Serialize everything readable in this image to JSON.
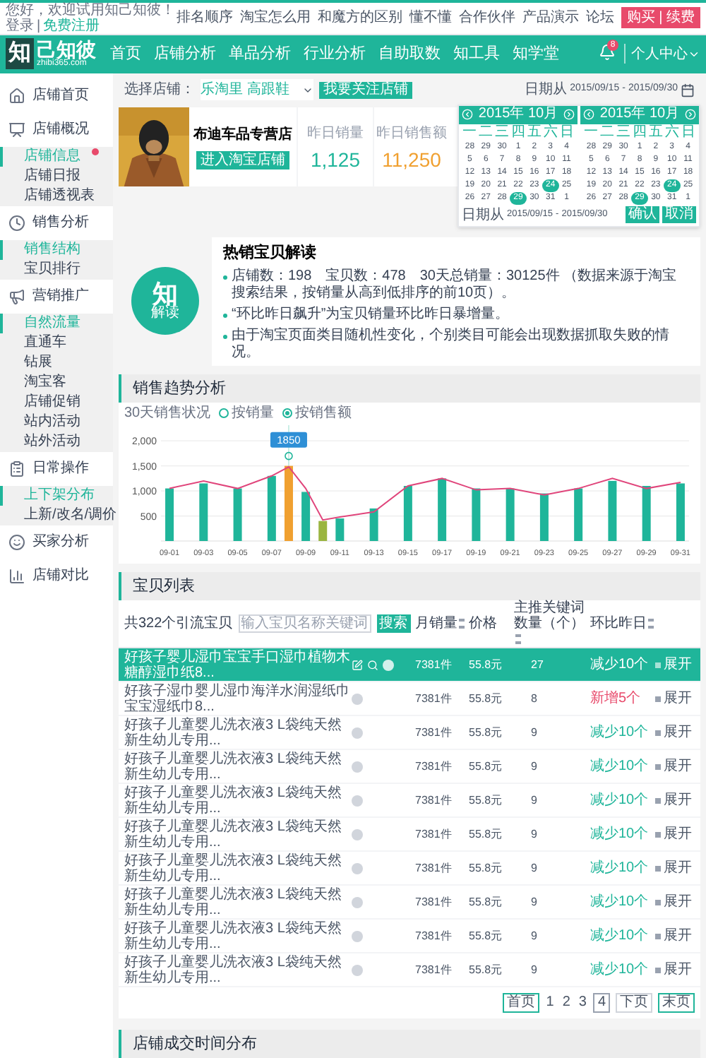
{
  "top_bar": {
    "greeting": "您好，欢迎试用知己知彼！",
    "login": "登录",
    "separator": "|",
    "register": "免费注册",
    "links": [
      "排名顺序",
      "淘宝怎么用",
      "和魔方的区别",
      "懂不懂",
      "合作伙伴",
      "产品演示",
      "论坛"
    ],
    "buy_button": "购买 | 续费"
  },
  "header": {
    "logo_mark": "知",
    "logo_text": "己知彼",
    "logo_url": "zhibi365.com",
    "nav": [
      "首页",
      "店铺分析",
      "单品分析",
      "行业分析",
      "自助取数",
      "知工具",
      "知学堂"
    ],
    "notification_count": "8",
    "user_menu": "个人中心"
  },
  "sidebar": [
    {
      "label": "店铺首页"
    },
    {
      "label": "店铺概况",
      "children": [
        {
          "label": "店铺信息",
          "selected": true,
          "has_badge": true
        },
        {
          "label": "店铺日报",
          "selected": false,
          "has_badge": false
        },
        {
          "label": "店铺透视表",
          "selected": false,
          "has_badge": false
        }
      ]
    },
    {
      "label": "销售分析",
      "children": [
        {
          "label": "销售结构",
          "selected": true,
          "has_badge": false
        },
        {
          "label": "宝贝排行",
          "selected": false,
          "has_badge": false
        }
      ]
    },
    {
      "label": "营销推广",
      "children": [
        {
          "label": "自然流量",
          "selected": true,
          "has_badge": false
        },
        {
          "label": "直通车",
          "selected": false,
          "has_badge": false
        },
        {
          "label": "钻展",
          "selected": false,
          "has_badge": false
        },
        {
          "label": "淘宝客",
          "selected": false,
          "has_badge": false
        },
        {
          "label": "店铺促销",
          "selected": false,
          "has_badge": false
        },
        {
          "label": "站内活动",
          "selected": false,
          "has_badge": false
        },
        {
          "label": "站外活动",
          "selected": false,
          "has_badge": false
        }
      ]
    },
    {
      "label": "日常操作",
      "children": [
        {
          "label": "上下架分布",
          "selected": true,
          "has_badge": false
        },
        {
          "label": "上新/改名/调价",
          "selected": false,
          "has_badge": false
        }
      ]
    },
    {
      "label": "买家分析"
    },
    {
      "label": "店铺对比"
    }
  ],
  "store_bar": {
    "label": "选择店铺：",
    "store": "乐淘里 高跟鞋",
    "follow_button": "我要关注店铺",
    "date_label": "日期从",
    "date_from": "2015/09/15",
    "date_separator": "-",
    "date_to": "2015/09/30"
  },
  "store_card": {
    "name": "布迪车品专营店",
    "enter_button": "进入淘宝店铺",
    "stats": [
      {
        "label": "昨日销量",
        "value": "1,125",
        "kind": "count"
      },
      {
        "label": "昨日销售额",
        "value": "11,250",
        "kind": "amount"
      }
    ]
  },
  "calendar": {
    "months": [
      {
        "title": "2015年 10月",
        "weekdays": [
          "一",
          "二",
          "三",
          "四",
          "五",
          "六",
          "日"
        ],
        "weeks": [
          [
            {
              "day": "28",
              "selected": false
            },
            {
              "day": "29",
              "selected": false
            },
            {
              "day": "30",
              "selected": false
            },
            {
              "day": "1",
              "selected": false
            },
            {
              "day": "2",
              "selected": false
            },
            {
              "day": "3",
              "selected": false
            },
            {
              "day": "4",
              "selected": false
            }
          ],
          [
            {
              "day": "5",
              "selected": false
            },
            {
              "day": "6",
              "selected": false
            },
            {
              "day": "7",
              "selected": false
            },
            {
              "day": "8",
              "selected": false
            },
            {
              "day": "9",
              "selected": false
            },
            {
              "day": "10",
              "selected": false
            },
            {
              "day": "11",
              "selected": false
            }
          ],
          [
            {
              "day": "12",
              "selected": false
            },
            {
              "day": "13",
              "selected": false
            },
            {
              "day": "14",
              "selected": false
            },
            {
              "day": "15",
              "selected": false
            },
            {
              "day": "16",
              "selected": false
            },
            {
              "day": "17",
              "selected": false
            },
            {
              "day": "18",
              "selected": false
            }
          ],
          [
            {
              "day": "19",
              "selected": false
            },
            {
              "day": "20",
              "selected": false
            },
            {
              "day": "21",
              "selected": false
            },
            {
              "day": "22",
              "selected": false
            },
            {
              "day": "23",
              "selected": false
            },
            {
              "day": "24",
              "selected": true
            },
            {
              "day": "25",
              "selected": false
            }
          ],
          [
            {
              "day": "26",
              "selected": false
            },
            {
              "day": "27",
              "selected": false
            },
            {
              "day": "28",
              "selected": false
            },
            {
              "day": "29",
              "selected": true
            },
            {
              "day": "30",
              "selected": false
            },
            {
              "day": "31",
              "selected": false
            },
            {
              "day": "1",
              "selected": false
            }
          ]
        ]
      },
      {
        "title": "2015年 10月",
        "weekdays": [
          "一",
          "二",
          "三",
          "四",
          "五",
          "六",
          "日"
        ],
        "weeks": [
          [
            {
              "day": "28",
              "selected": false
            },
            {
              "day": "29",
              "selected": false
            },
            {
              "day": "30",
              "selected": false
            },
            {
              "day": "1",
              "selected": false
            },
            {
              "day": "2",
              "selected": false
            },
            {
              "day": "3",
              "selected": false
            },
            {
              "day": "4",
              "selected": false
            }
          ],
          [
            {
              "day": "5",
              "selected": false
            },
            {
              "day": "6",
              "selected": false
            },
            {
              "day": "7",
              "selected": false
            },
            {
              "day": "8",
              "selected": false
            },
            {
              "day": "9",
              "selected": false
            },
            {
              "day": "10",
              "selected": false
            },
            {
              "day": "11",
              "selected": false
            }
          ],
          [
            {
              "day": "12",
              "selected": false
            },
            {
              "day": "13",
              "selected": false
            },
            {
              "day": "14",
              "selected": false
            },
            {
              "day": "15",
              "selected": false
            },
            {
              "day": "16",
              "selected": false
            },
            {
              "day": "17",
              "selected": false
            },
            {
              "day": "18",
              "selected": false
            }
          ],
          [
            {
              "day": "19",
              "selected": false
            },
            {
              "day": "20",
              "selected": false
            },
            {
              "day": "21",
              "selected": false
            },
            {
              "day": "22",
              "selected": false
            },
            {
              "day": "23",
              "selected": false
            },
            {
              "day": "24",
              "selected": true
            },
            {
              "day": "25",
              "selected": false
            }
          ],
          [
            {
              "day": "26",
              "selected": false
            },
            {
              "day": "27",
              "selected": false
            },
            {
              "day": "28",
              "selected": false
            },
            {
              "day": "29",
              "selected": true
            },
            {
              "day": "30",
              "selected": false
            },
            {
              "day": "31",
              "selected": false
            },
            {
              "day": "1",
              "selected": false
            }
          ]
        ]
      }
    ],
    "footer": {
      "date_label": "日期从",
      "date_from": "2015/09/15",
      "date_separator": "-",
      "date_to": "2015/09/30"
    },
    "buttons": [
      "确认",
      "取消"
    ]
  },
  "insight": {
    "badge_main": "知",
    "badge_sub": "解读",
    "title": "热销宝贝解读",
    "bullets": [
      "店铺数：198　宝贝数：478　30天总销量：30125件 （数据来源于淘宝搜索结果，按销量从高到低排序的前10页）。",
      "“环比昨日飙升”为宝贝销量环比昨日暴增量。",
      "由于淘宝页面类目随机性变化，个别类目可能会出现数据抓取失败的情况。"
    ]
  },
  "sales": {
    "title": "销售趋势分析",
    "status_label": "30天销售状况",
    "options": [
      {
        "label": "按销量",
        "selected": false
      },
      {
        "label": "按销售额",
        "selected": true
      }
    ],
    "tooltip": "1850",
    "chart_data": {
      "type": "bar",
      "grid": true,
      "ylim": [
        0,
        2200
      ],
      "categories": [
        "09-01",
        null,
        "09-03",
        null,
        "09-05",
        null,
        "09-07",
        null,
        "09-09",
        null,
        "09-11",
        null,
        "09-13",
        null,
        "09-15",
        null,
        "09-17",
        null,
        "09-19",
        null,
        "09-21",
        null,
        "09-23",
        null,
        "09-25",
        null,
        "09-27",
        null,
        "09-29",
        null,
        "09-31"
      ],
      "yticks": [
        {
          "value": 500,
          "label": "500"
        },
        {
          "value": 1000,
          "label": "1,000"
        },
        {
          "value": 1500,
          "label": "1,500"
        },
        {
          "value": 2000,
          "label": "2,000"
        }
      ],
      "series": [
        {
          "color": "#1fb59a",
          "values": [
            1050,
            null,
            1150,
            null,
            1050,
            null,
            1300,
            null,
            980,
            null,
            450,
            null,
            650,
            null,
            1100,
            null,
            1250,
            null,
            1050,
            null,
            1050,
            null,
            950,
            null,
            1050,
            null,
            1200,
            null,
            1100,
            null,
            1150
          ]
        },
        {
          "color": "#f0a030",
          "values": [
            null,
            null,
            null,
            null,
            null,
            null,
            null,
            1500,
            null,
            null,
            null,
            null,
            null,
            null,
            null,
            null,
            null,
            null,
            null,
            null,
            null,
            null,
            null,
            null,
            null,
            null,
            null,
            null,
            null,
            null,
            null
          ]
        },
        {
          "color": "#9ab540",
          "values": [
            null,
            null,
            null,
            null,
            null,
            null,
            null,
            null,
            null,
            400,
            null,
            null,
            null,
            null,
            null,
            null,
            null,
            null,
            null,
            null,
            null,
            null,
            null,
            null,
            null,
            null,
            null,
            null,
            null,
            null,
            null
          ]
        },
        {
          "type": "line",
          "color": "#e0457b",
          "values": [
            1050,
            null,
            1200,
            null,
            1050,
            null,
            1300,
            1480,
            1050,
            420,
            480,
            null,
            580,
            null,
            1100,
            null,
            1250,
            null,
            1020,
            null,
            1050,
            null,
            920,
            null,
            1050,
            null,
            1250,
            null,
            1050,
            null,
            1170
          ]
        }
      ]
    }
  },
  "products": {
    "title": "宝贝列表",
    "count": "共322个引流宝贝",
    "search": {
      "placeholder": "输入宝贝名称关键词"
    },
    "search_button": "搜索",
    "columns": [
      {
        "label": "月销量",
        "sortable": true
      },
      {
        "label": "价格",
        "sortable": false
      },
      {
        "label": "主推关键词数量（个）",
        "sortable": true
      },
      {
        "label": "环比昨日",
        "sortable": true
      }
    ],
    "rows": [
      {
        "name": "好孩子婴儿湿巾宝宝手口湿巾植物木糖醇湿巾纸8...",
        "sales": "7381件",
        "price": "55.8元",
        "keywords": "27",
        "change": "减少10个",
        "kind": "down",
        "action": "展开",
        "selected": true
      },
      {
        "name": "好孩子湿巾婴儿湿巾海洋水润湿纸巾宝宝湿纸巾8...",
        "sales": "7381件",
        "price": "55.8元",
        "keywords": "8",
        "change": "新增5个",
        "kind": "up",
        "action": "展开",
        "selected": false
      },
      {
        "name": "好孩子儿童婴儿洗衣液3 L袋纯天然新生幼儿专用...",
        "sales": "7381件",
        "price": "55.8元",
        "keywords": "9",
        "change": "减少10个",
        "kind": "down",
        "action": "展开",
        "selected": false
      },
      {
        "name": "好孩子儿童婴儿洗衣液3 L袋纯天然新生幼儿专用...",
        "sales": "7381件",
        "price": "55.8元",
        "keywords": "9",
        "change": "减少10个",
        "kind": "down",
        "action": "展开",
        "selected": false
      },
      {
        "name": "好孩子儿童婴儿洗衣液3 L袋纯天然新生幼儿专用...",
        "sales": "7381件",
        "price": "55.8元",
        "keywords": "9",
        "change": "减少10个",
        "kind": "down",
        "action": "展开",
        "selected": false
      },
      {
        "name": "好孩子儿童婴儿洗衣液3 L袋纯天然新生幼儿专用...",
        "sales": "7381件",
        "price": "55.8元",
        "keywords": "9",
        "change": "减少10个",
        "kind": "down",
        "action": "展开",
        "selected": false
      },
      {
        "name": "好孩子儿童婴儿洗衣液3 L袋纯天然新生幼儿专用...",
        "sales": "7381件",
        "price": "55.8元",
        "keywords": "9",
        "change": "减少10个",
        "kind": "down",
        "action": "展开",
        "selected": false
      },
      {
        "name": "好孩子儿童婴儿洗衣液3 L袋纯天然新生幼儿专用...",
        "sales": "7381件",
        "price": "55.8元",
        "keywords": "9",
        "change": "减少10个",
        "kind": "down",
        "action": "展开",
        "selected": false
      },
      {
        "name": "好孩子儿童婴儿洗衣液3 L袋纯天然新生幼儿专用...",
        "sales": "7381件",
        "price": "55.8元",
        "keywords": "9",
        "change": "减少10个",
        "kind": "down",
        "action": "展开",
        "selected": false
      },
      {
        "name": "好孩子儿童婴儿洗衣液3 L袋纯天然新生幼儿专用...",
        "sales": "7381件",
        "price": "55.8元",
        "keywords": "9",
        "change": "减少10个",
        "kind": "down",
        "action": "展开",
        "selected": false
      }
    ],
    "pagination": [
      {
        "label": "首页",
        "kind": "first",
        "selected": false
      },
      {
        "label": "1",
        "kind": "page",
        "selected": false
      },
      {
        "label": "2",
        "kind": "page",
        "selected": false
      },
      {
        "label": "3",
        "kind": "page",
        "selected": false
      },
      {
        "label": "4",
        "kind": "page",
        "selected": true
      },
      {
        "label": "下页",
        "kind": "next",
        "selected": false
      },
      {
        "label": "末页",
        "kind": "last",
        "selected": false
      }
    ]
  },
  "distribution": {
    "title": "店铺成交时间分布"
  }
}
